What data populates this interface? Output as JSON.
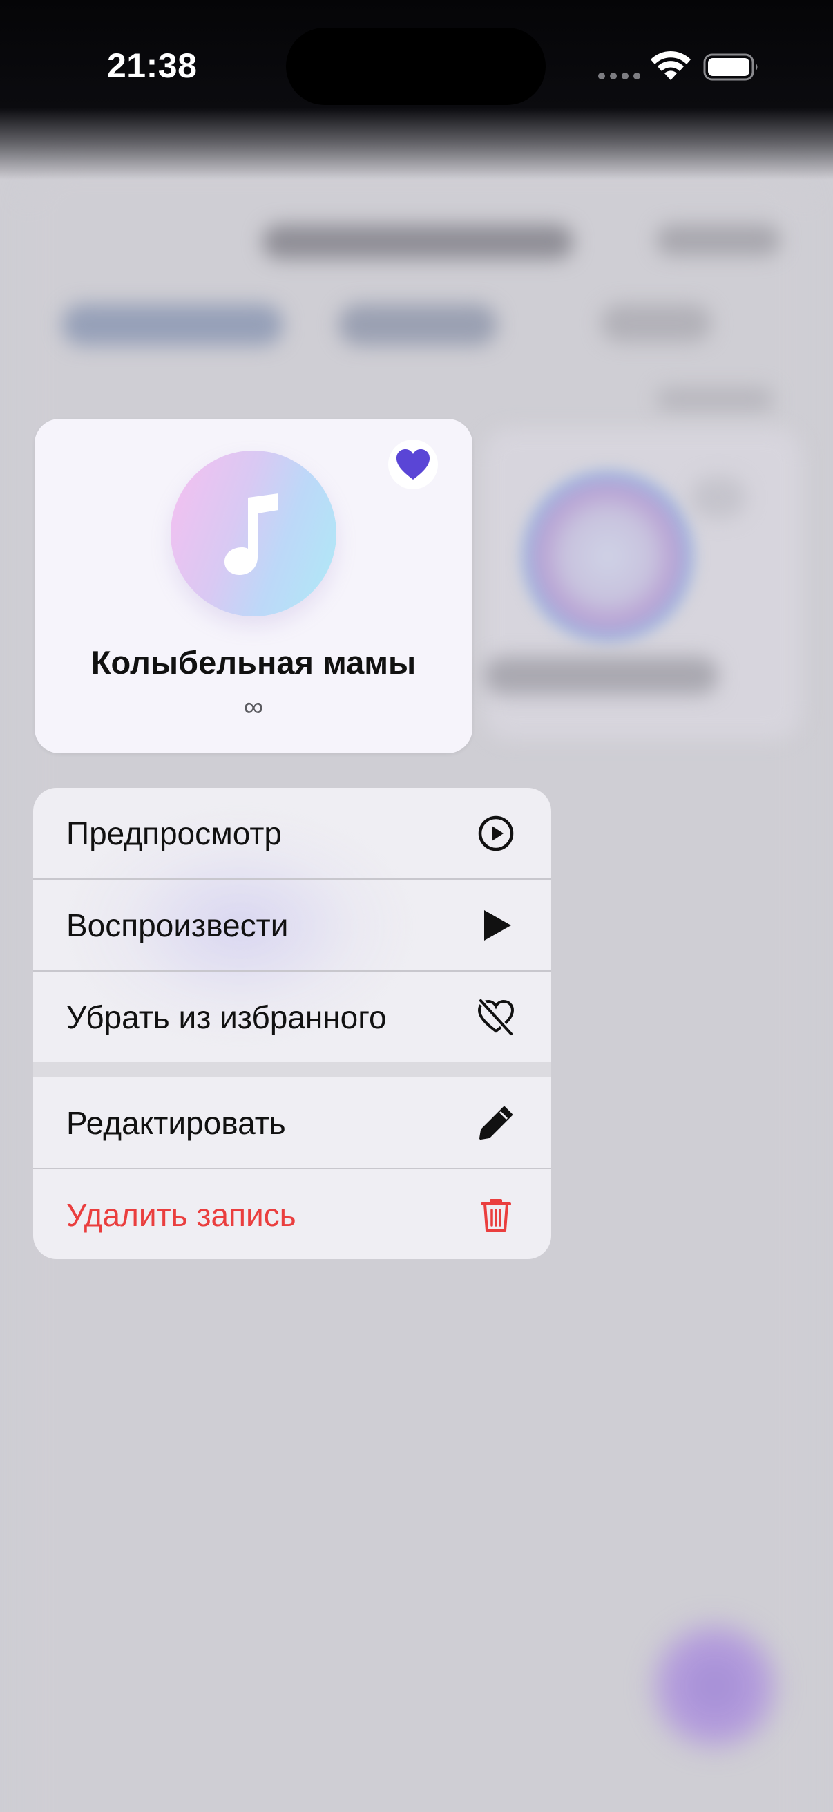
{
  "status_bar": {
    "time": "21:38"
  },
  "preview": {
    "title": "Колыбельная мамы",
    "duration": "∞",
    "artwork_icon": "music-note-icon",
    "favorite_icon": "heart-filled-icon",
    "colors": {
      "favorite": "#5a45d6",
      "artwork_gradient": [
        "#f6bff0",
        "#aeeaf6"
      ]
    }
  },
  "context_menu": {
    "items": [
      {
        "label": "Предпросмотр",
        "icon": "play-circle-icon"
      },
      {
        "label": "Воспроизвести",
        "icon": "play-icon"
      },
      {
        "label": "Убрать из избранного",
        "icon": "heart-slash-icon"
      },
      {
        "label": "Редактировать",
        "icon": "pencil-icon"
      },
      {
        "label": "Удалить запись",
        "icon": "trash-icon",
        "destructive": true
      }
    ],
    "colors": {
      "destructive": "#ea3e3e"
    }
  }
}
